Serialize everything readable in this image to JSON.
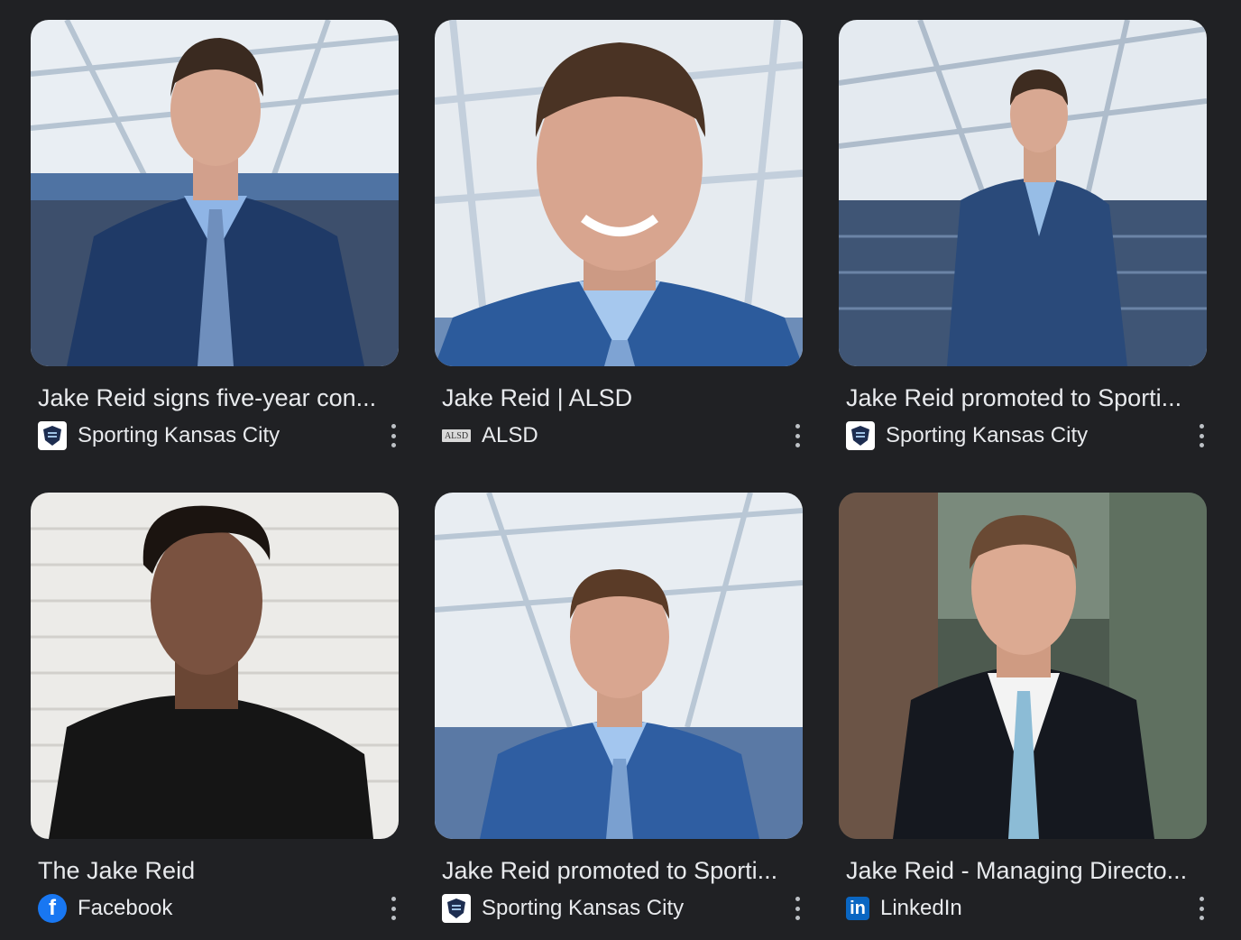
{
  "results": [
    {
      "title": "Jake Reid signs five-year con...",
      "source": "Sporting Kansas City",
      "source_icon": "sporting-kc-logo",
      "image": "man in navy suit at stadium"
    },
    {
      "title": "Jake Reid | ALSD",
      "source": "ALSD",
      "source_icon": "alsd-logo",
      "image": "close-up headshot man in blue suit"
    },
    {
      "title": "Jake Reid promoted to Sporti...",
      "source": "Sporting Kansas City",
      "source_icon": "sporting-kc-logo",
      "image": "man in suit walking in stadium"
    },
    {
      "title": "The Jake Reid",
      "source": "Facebook",
      "source_icon": "facebook-logo",
      "image": "young man in black shirt"
    },
    {
      "title": "Jake Reid promoted to Sporti...",
      "source": "Sporting Kansas City",
      "source_icon": "sporting-kc-logo",
      "image": "man in blue suit at stadium"
    },
    {
      "title": "Jake Reid - Managing Directo...",
      "source": "LinkedIn",
      "source_icon": "linkedin-logo",
      "image": "man in dark suit professional headshot"
    }
  ],
  "icons": {
    "alsd_text": "ALSD",
    "facebook_text": "f",
    "linkedin_text": "in"
  },
  "colors": {
    "background": "#202124",
    "text": "#e8eaed",
    "facebook": "#1877f2",
    "linkedin": "#0a66c2"
  }
}
